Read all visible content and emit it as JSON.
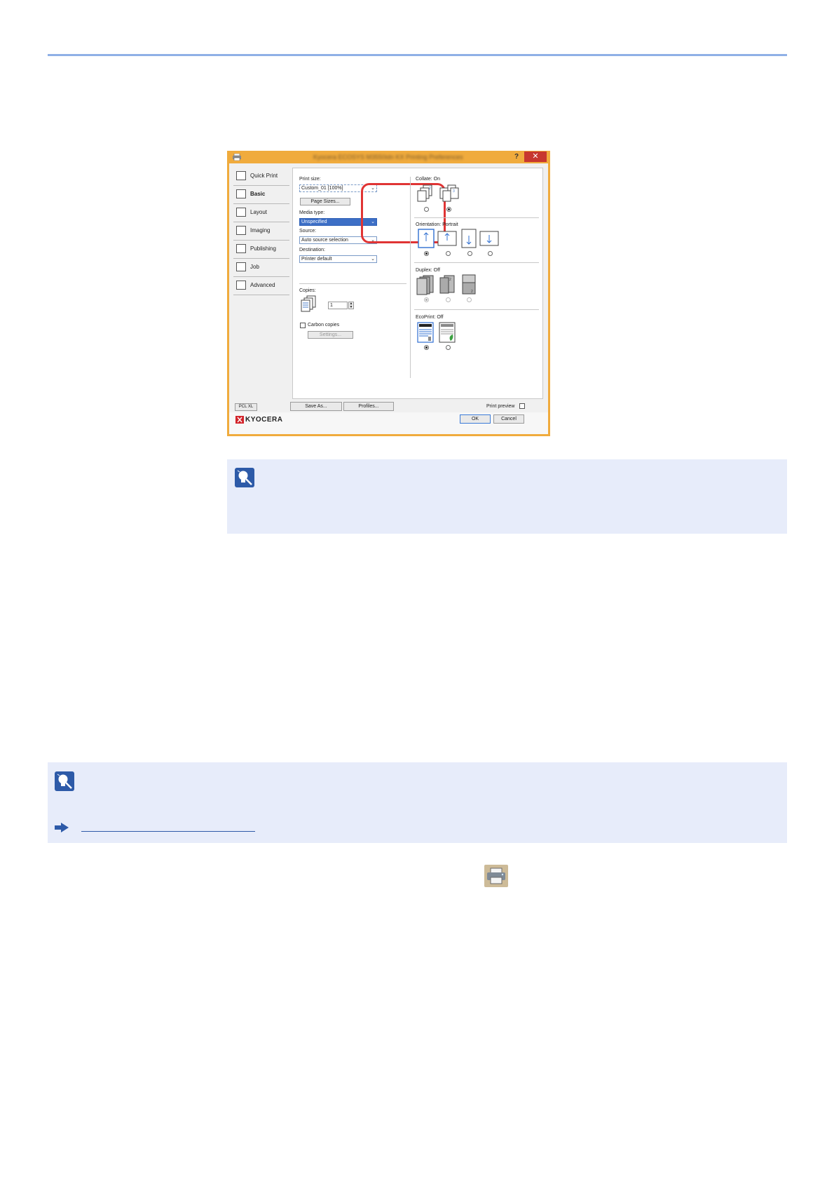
{
  "dialog": {
    "title": "Kyocera ECOSYS M3550idn KX Printing Preferences",
    "help": "?",
    "close": "✕",
    "nav": [
      {
        "label": "Quick Print",
        "icon": "quick-print-icon"
      },
      {
        "label": "Basic",
        "icon": "basic-icon"
      },
      {
        "label": "Layout",
        "icon": "layout-icon"
      },
      {
        "label": "Imaging",
        "icon": "imaging-icon"
      },
      {
        "label": "Publishing",
        "icon": "publishing-icon"
      },
      {
        "label": "Job",
        "icon": "job-icon"
      },
      {
        "label": "Advanced",
        "icon": "advanced-icon"
      }
    ],
    "print_size_label": "Print size:",
    "print_size_value": "Custom_01 [100%]",
    "page_sizes_button": "Page Sizes...",
    "media_type_label": "Media type:",
    "media_type_value": "Unspecified",
    "source_label": "Source:",
    "source_value": "Auto source selection",
    "destination_label": "Destination:",
    "destination_value": "Printer default",
    "copies_label": "Copies:",
    "copies_value": "1",
    "carbon_copies_label": "Carbon copies",
    "settings_button": "Settings...",
    "collate_label": "Collate:  On",
    "orientation_label": "Orientation:  Portrait",
    "duplex_label": "Duplex:  Off",
    "ecoprint_label": "EcoPrint:  Off",
    "pcl_button": "PCL XL",
    "save_as_button": "Save As...",
    "profiles_button": "Profiles...",
    "print_preview_label": "Print preview",
    "brand": "KYOCERA",
    "ok_button": "OK",
    "cancel_button": "Cancel"
  },
  "colors": {
    "note_background": "#e7ecfa",
    "rule": "#8fb0e6",
    "highlight_ring": "#e03434",
    "window_frame": "#f0ab3d"
  },
  "icons": {
    "note": "lightbulb-note-icon",
    "link": "right-arrow-icon",
    "printer": "printer-icon"
  }
}
